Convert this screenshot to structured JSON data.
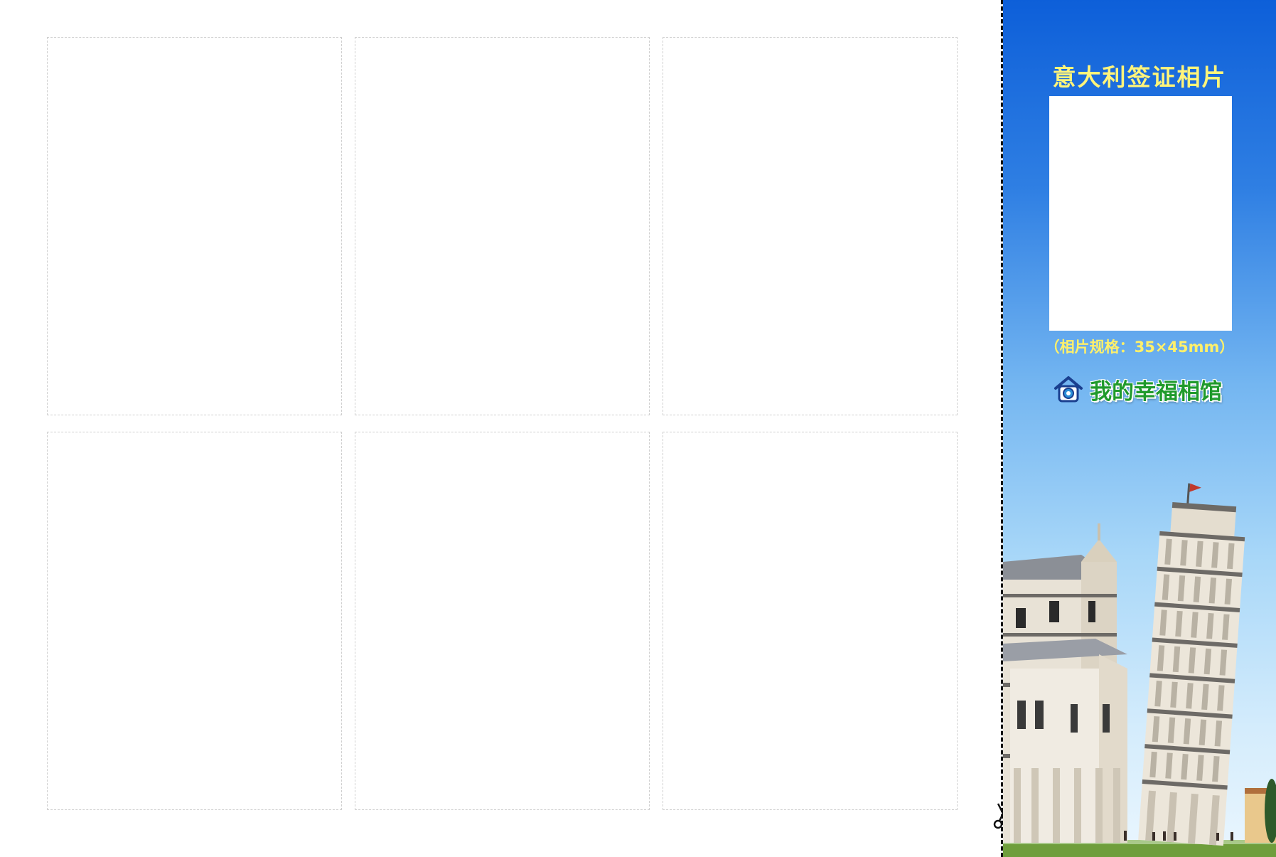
{
  "panel": {
    "title": "意大利签证相片",
    "spec": "（相片规格：35×45mm）",
    "brand_name": "我的幸福相馆",
    "accent_color": "#fff47a",
    "brand_color": "#1f9a2c",
    "background_top": "#0d5fd9",
    "background_bottom": "#eaf6fe"
  },
  "photo_slots": {
    "count": 6,
    "rows": 2,
    "columns": 3
  },
  "icons": [
    "scissors-icon",
    "camera-house-icon"
  ]
}
